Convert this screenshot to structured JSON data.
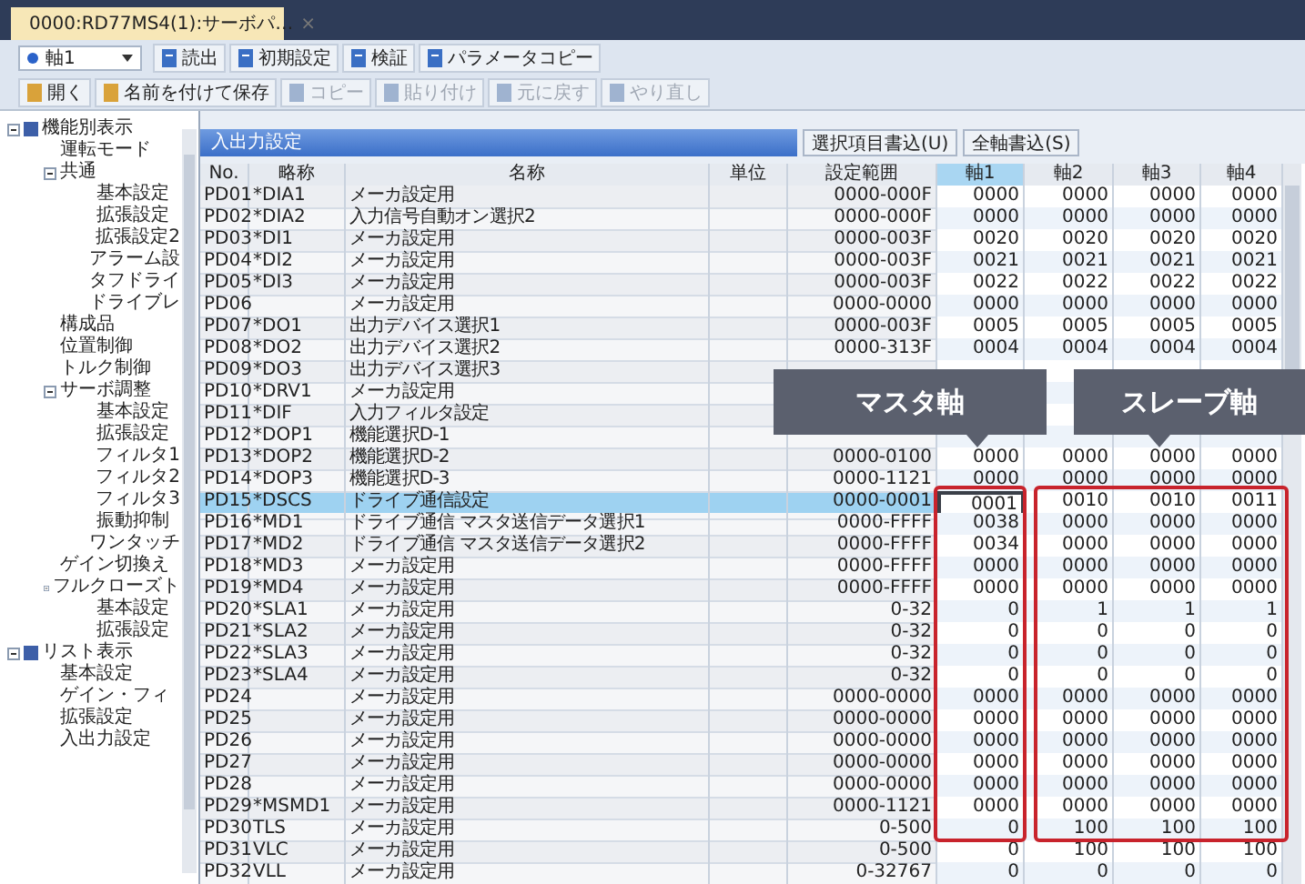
{
  "window": {
    "tab": {
      "title": "0000:RD77MS4(1):サーボパ…",
      "close": "×"
    }
  },
  "toolbar": {
    "axis_select": {
      "value": "軸1"
    },
    "buttons": [
      {
        "label": "読出",
        "disabled": false
      },
      {
        "label": "初期設定",
        "disabled": false
      },
      {
        "label": "検証",
        "disabled": false
      },
      {
        "label": "パラメータコピー",
        "disabled": false
      }
    ]
  },
  "toolbar2": {
    "buttons": [
      {
        "label": "開く",
        "disabled": false
      },
      {
        "label": "名前を付けて保存",
        "disabled": false
      },
      {
        "label": "コピー",
        "disabled": true
      },
      {
        "label": "貼り付け",
        "disabled": true
      },
      {
        "label": "元に戻す",
        "disabled": true
      },
      {
        "label": "やり直し",
        "disabled": true
      }
    ]
  },
  "tree": [
    {
      "label": "機能別表示",
      "expanded": true,
      "children": [
        {
          "label": "運転モード"
        },
        {
          "label": "共通",
          "expanded": true,
          "children": [
            {
              "label": "基本設定"
            },
            {
              "label": "拡張設定"
            },
            {
              "label": "拡張設定2"
            },
            {
              "label": "アラーム設"
            },
            {
              "label": "タフドライ"
            },
            {
              "label": "ドライブレ"
            }
          ]
        },
        {
          "label": "構成品"
        },
        {
          "label": "位置制御"
        },
        {
          "label": "トルク制御"
        },
        {
          "label": "サーボ調整",
          "expanded": true,
          "children": [
            {
              "label": "基本設定"
            },
            {
              "label": "拡張設定"
            },
            {
              "label": "フィルタ1"
            },
            {
              "label": "フィルタ2"
            },
            {
              "label": "フィルタ3"
            },
            {
              "label": "振動抑制"
            },
            {
              "label": "ワンタッチ"
            }
          ]
        },
        {
          "label": "ゲイン切換え"
        },
        {
          "label": "フルクローズト",
          "expanded": true,
          "children": [
            {
              "label": "基本設定"
            },
            {
              "label": "拡張設定"
            }
          ]
        }
      ]
    },
    {
      "label": "リスト表示",
      "expanded": true,
      "children": [
        {
          "label": "基本設定"
        },
        {
          "label": "ゲイン・フィ"
        },
        {
          "label": "拡張設定"
        },
        {
          "label": "入出力設定"
        }
      ]
    }
  ],
  "panel": {
    "title": "入出力設定",
    "buttons": [
      "選択項目書込(U)",
      "全軸書込(S)"
    ]
  },
  "table": {
    "columns": [
      "No.",
      "略称",
      "名称",
      "単位",
      "設定範囲"
    ],
    "axes": [
      {
        "label": "軸1",
        "selected": true
      },
      {
        "label": "軸2",
        "selected": false
      },
      {
        "label": "軸3",
        "selected": false
      },
      {
        "label": "軸4",
        "selected": false
      }
    ],
    "rows": [
      {
        "no": "PD01",
        "abbr": "*DIA1",
        "name": "メーカ設定用",
        "range": "0000-000F",
        "values": [
          "0000",
          "0000",
          "0000",
          "0000"
        ],
        "selected": false
      },
      {
        "no": "PD02",
        "abbr": "*DIA2",
        "name": "入力信号自動オン選択2",
        "range": "0000-000F",
        "values": [
          "0000",
          "0000",
          "0000",
          "0000"
        ],
        "selected": false
      },
      {
        "no": "PD03",
        "abbr": "*DI1",
        "name": "メーカ設定用",
        "range": "0000-003F",
        "values": [
          "0020",
          "0020",
          "0020",
          "0020"
        ],
        "selected": false
      },
      {
        "no": "PD04",
        "abbr": "*DI2",
        "name": "メーカ設定用",
        "range": "0000-003F",
        "values": [
          "0021",
          "0021",
          "0021",
          "0021"
        ],
        "selected": false
      },
      {
        "no": "PD05",
        "abbr": "*DI3",
        "name": "メーカ設定用",
        "range": "0000-003F",
        "values": [
          "0022",
          "0022",
          "0022",
          "0022"
        ],
        "selected": false
      },
      {
        "no": "PD06",
        "name": "メーカ設定用",
        "range": "0000-0000",
        "values": [
          "0000",
          "0000",
          "0000",
          "0000"
        ],
        "selected": false
      },
      {
        "no": "PD07",
        "abbr": "*DO1",
        "name": "出力デバイス選択1",
        "range": "0000-003F",
        "values": [
          "0005",
          "0005",
          "0005",
          "0005"
        ],
        "selected": false
      },
      {
        "no": "PD08",
        "abbr": "*DO2",
        "name": "出力デバイス選択2",
        "range": "0000-313F",
        "values": [
          "0004",
          "0004",
          "0004",
          "0004"
        ],
        "selected": false
      },
      {
        "no": "PD09",
        "abbr": "*DO3",
        "name": "出力デバイス選択3",
        "selected": false
      },
      {
        "no": "PD10",
        "abbr": "*DRV1",
        "name": "メーカ設定用",
        "selected": false
      },
      {
        "no": "PD11",
        "abbr": "*DIF",
        "name": "入力フィルタ設定",
        "selected": false
      },
      {
        "no": "PD12",
        "abbr": "*DOP1",
        "name": "機能選択D-1",
        "selected": false
      },
      {
        "no": "PD13",
        "abbr": "*DOP2",
        "name": "機能選択D-2",
        "range": "0000-0100",
        "values": [
          "0000",
          "0000",
          "0000",
          "0000"
        ],
        "selected": false
      },
      {
        "no": "PD14",
        "abbr": "*DOP3",
        "name": "機能選択D-3",
        "range": "0000-1121",
        "values": [
          "0000",
          "0000",
          "0000",
          "0000"
        ],
        "selected": false
      },
      {
        "no": "PD15",
        "abbr": "*DSCS",
        "name": "ドライブ通信設定",
        "range": "0000-0001",
        "values": [
          "0001",
          "0010",
          "0010",
          "0011"
        ],
        "selected": true
      },
      {
        "no": "PD16",
        "abbr": "*MD1",
        "name": "ドライブ通信 マスタ送信データ選択1",
        "range": "0000-FFFF",
        "values": [
          "0038",
          "0000",
          "0000",
          "0000"
        ],
        "selected": false
      },
      {
        "no": "PD17",
        "abbr": "*MD2",
        "name": "ドライブ通信 マスタ送信データ選択2",
        "range": "0000-FFFF",
        "values": [
          "0034",
          "0000",
          "0000",
          "0000"
        ],
        "selected": false
      },
      {
        "no": "PD18",
        "abbr": "*MD3",
        "name": "メーカ設定用",
        "range": "0000-FFFF",
        "values": [
          "0000",
          "0000",
          "0000",
          "0000"
        ],
        "selected": false
      },
      {
        "no": "PD19",
        "abbr": "*MD4",
        "name": "メーカ設定用",
        "range": "0000-FFFF",
        "values": [
          "0000",
          "0000",
          "0000",
          "0000"
        ],
        "selected": false
      },
      {
        "no": "PD20",
        "abbr": "*SLA1",
        "name": "メーカ設定用",
        "range": "0-32",
        "values": [
          "0",
          "1",
          "1",
          "1"
        ],
        "selected": false
      },
      {
        "no": "PD21",
        "abbr": "*SLA2",
        "name": "メーカ設定用",
        "range": "0-32",
        "values": [
          "0",
          "0",
          "0",
          "0"
        ],
        "selected": false
      },
      {
        "no": "PD22",
        "abbr": "*SLA3",
        "name": "メーカ設定用",
        "range": "0-32",
        "values": [
          "0",
          "0",
          "0",
          "0"
        ],
        "selected": false
      },
      {
        "no": "PD23",
        "abbr": "*SLA4",
        "name": "メーカ設定用",
        "range": "0-32",
        "values": [
          "0",
          "0",
          "0",
          "0"
        ],
        "selected": false
      },
      {
        "no": "PD24",
        "name": "メーカ設定用",
        "range": "0000-0000",
        "values": [
          "0000",
          "0000",
          "0000",
          "0000"
        ],
        "selected": false
      },
      {
        "no": "PD25",
        "name": "メーカ設定用",
        "range": "0000-0000",
        "values": [
          "0000",
          "0000",
          "0000",
          "0000"
        ],
        "selected": false
      },
      {
        "no": "PD26",
        "name": "メーカ設定用",
        "range": "0000-0000",
        "values": [
          "0000",
          "0000",
          "0000",
          "0000"
        ],
        "selected": false
      },
      {
        "no": "PD27",
        "name": "メーカ設定用",
        "range": "0000-0000",
        "values": [
          "0000",
          "0000",
          "0000",
          "0000"
        ],
        "selected": false
      },
      {
        "no": "PD28",
        "name": "メーカ設定用",
        "range": "0000-0000",
        "values": [
          "0000",
          "0000",
          "0000",
          "0000"
        ],
        "selected": false
      },
      {
        "no": "PD29",
        "abbr": "*MSMD1",
        "name": "メーカ設定用",
        "range": "0000-1121",
        "values": [
          "0000",
          "0000",
          "0000",
          "0000"
        ],
        "selected": false
      },
      {
        "no": "PD30",
        "abbr": "TLS",
        "name": "メーカ設定用",
        "range": "0-500",
        "values": [
          "0",
          "100",
          "100",
          "100"
        ],
        "selected": false
      },
      {
        "no": "PD31",
        "abbr": "VLC",
        "name": "メーカ設定用",
        "range": "0-500",
        "values": [
          "0",
          "100",
          "100",
          "100"
        ],
        "selected": false
      },
      {
        "no": "PD32",
        "abbr": "VLL",
        "name": "メーカ設定用",
        "range": "0-32767",
        "values": [
          "0",
          "0",
          "0",
          "0"
        ],
        "selected": false
      }
    ]
  },
  "callouts": [
    {
      "label": "マスタ軸",
      "kind": "master"
    },
    {
      "label": "スレーブ軸",
      "kind": "slave"
    }
  ]
}
